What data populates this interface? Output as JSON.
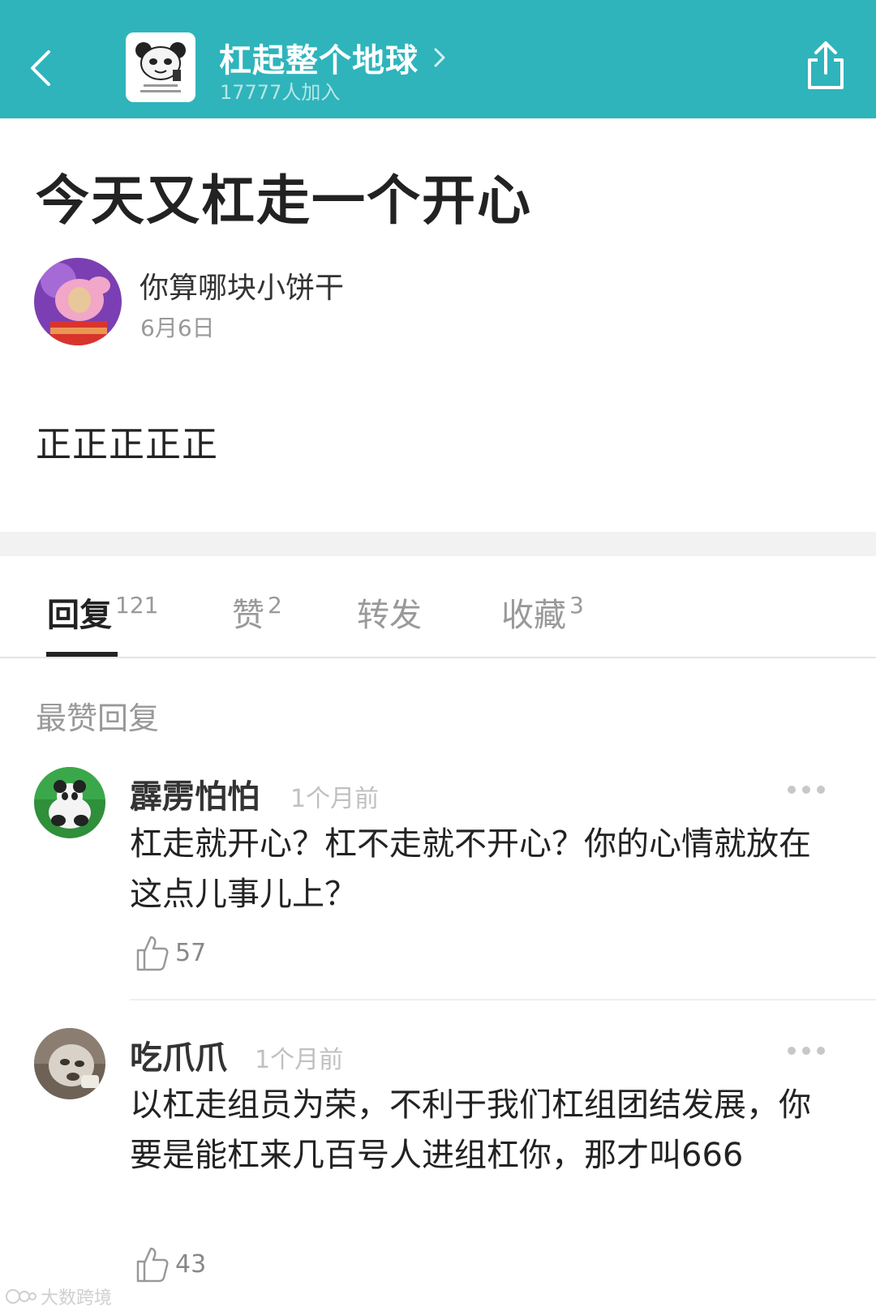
{
  "header": {
    "group_title": "杠起整个地球",
    "member_count": "17777人加入",
    "bg_color": "#2fb4bb",
    "icons": [
      "back-icon",
      "chevron-right-icon",
      "share-icon"
    ]
  },
  "post": {
    "title": "今天又杠走一个开心",
    "author": "你算哪块小饼干",
    "date": "6月6日",
    "body": "正正正正正"
  },
  "tabs": [
    {
      "label": "回复",
      "count": "121",
      "active": true
    },
    {
      "label": "赞",
      "count": "2",
      "active": false
    },
    {
      "label": "转发",
      "count": "",
      "active": false
    },
    {
      "label": "收藏",
      "count": "3",
      "active": false
    }
  ],
  "section_label": "最赞回复",
  "comments": [
    {
      "name": "霹雳怕怕",
      "time": "1个月前",
      "text": "杠走就开心？杠不走就不开心？你的心情就放在这点儿事儿上？",
      "likes": "57"
    },
    {
      "name": "吃爪爪",
      "time": "1个月前",
      "text": "以杠走组员为荣，不利于我们杠组团结发展，你要是能杠来几百号人进组杠你，那才叫666",
      "likes": "43"
    }
  ],
  "watermark": "大数跨境"
}
